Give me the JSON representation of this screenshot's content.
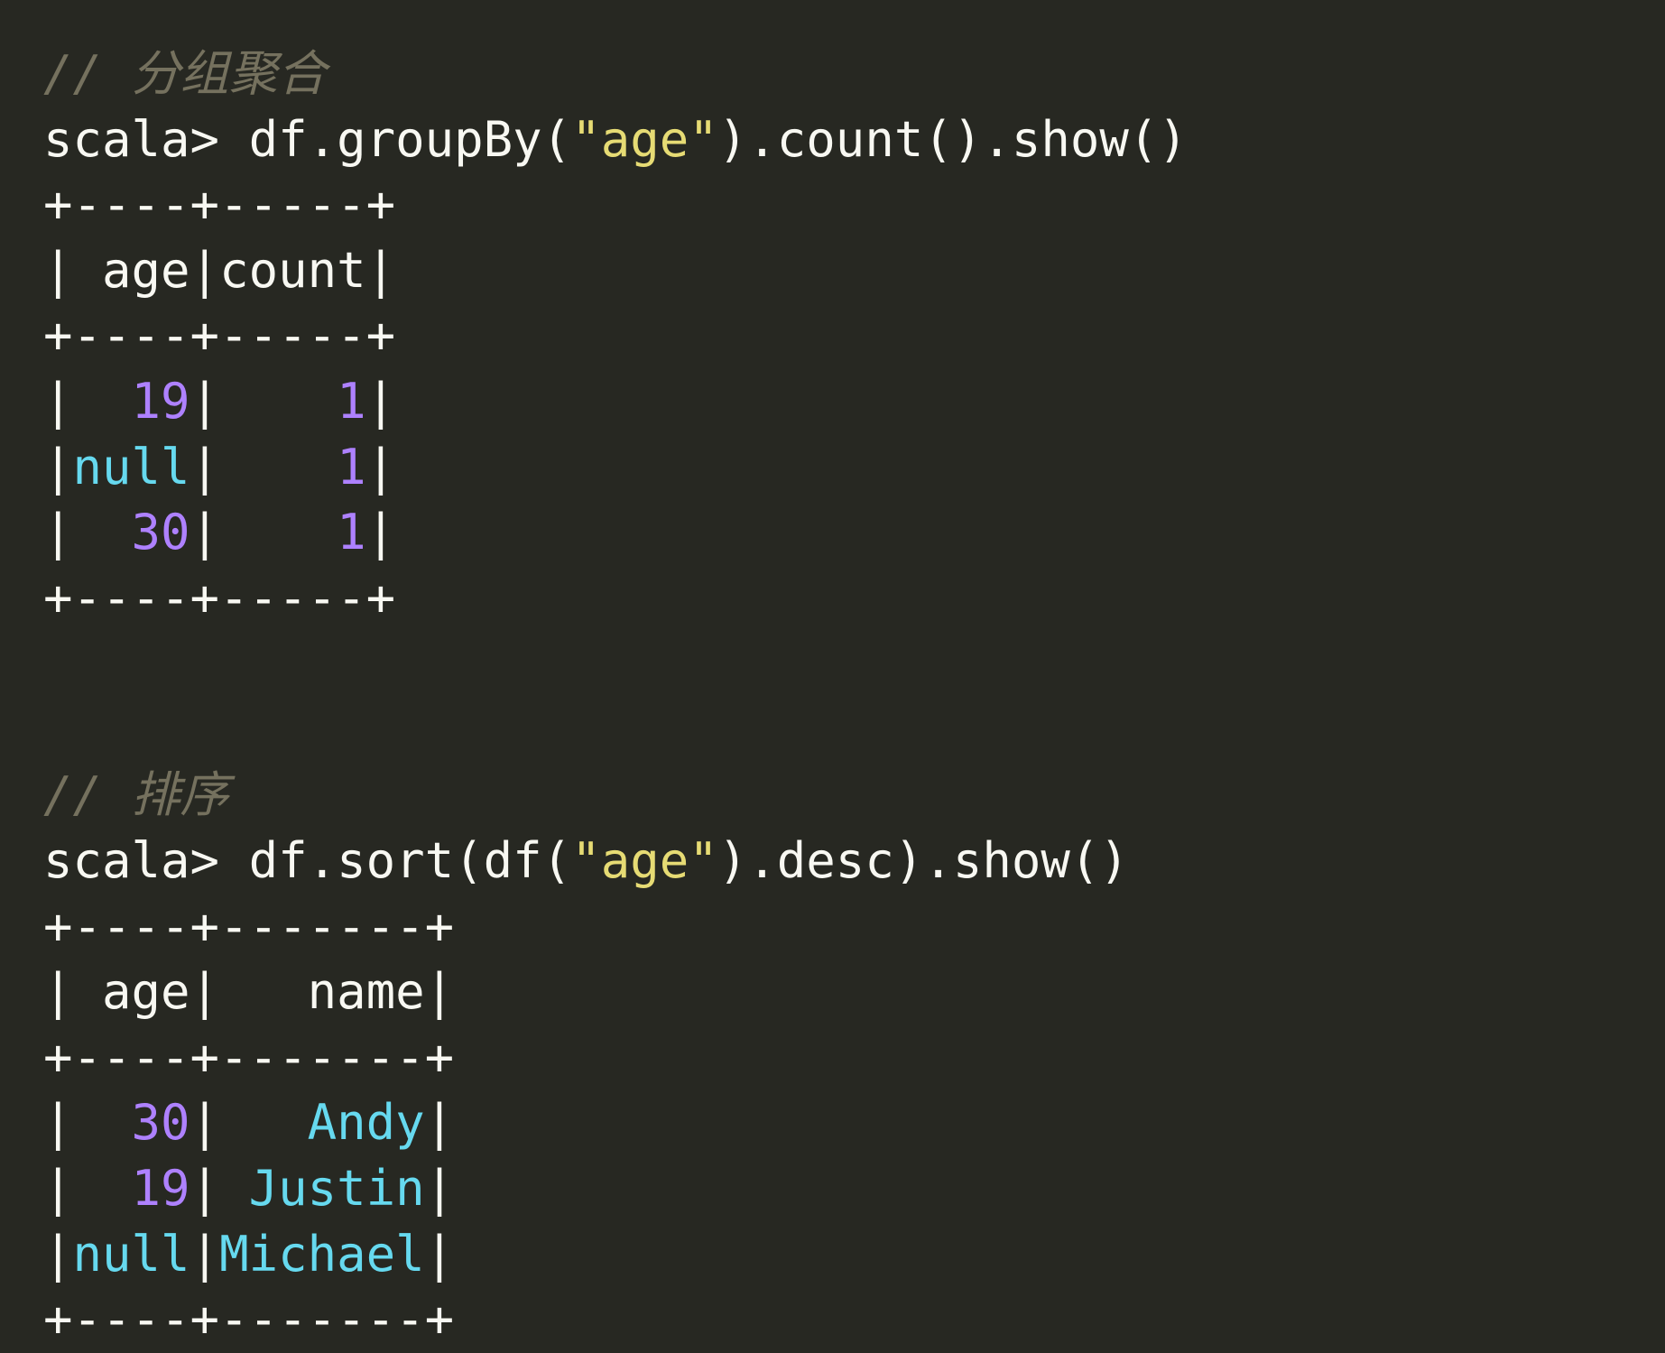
{
  "colors": {
    "background": "#272822",
    "text": "#f8f8f2",
    "comment": "#75715e",
    "string": "#e6db74",
    "number": "#ae81ff",
    "identifier": "#66d9ef"
  },
  "block1": {
    "comment": "// 分组聚合",
    "prompt": "scala> ",
    "cmd_pre": "df.groupBy(",
    "cmd_str": "\"age\"",
    "cmd_post": ").count().show()",
    "border": "+----+-----+",
    "header": "| age|count|",
    "rows": [
      {
        "lead": "|  ",
        "age": "19",
        "mid": "|    ",
        "count": "1",
        "end": "|"
      },
      {
        "lead": "|",
        "age": "null",
        "mid": "|    ",
        "count": "1",
        "end": "|"
      },
      {
        "lead": "|  ",
        "age": "30",
        "mid": "|    ",
        "count": "1",
        "end": "|"
      }
    ]
  },
  "block2": {
    "comment": "// 排序",
    "prompt": "scala> ",
    "cmd_pre": "df.sort(df(",
    "cmd_str": "\"age\"",
    "cmd_post": ").desc).show()",
    "border": "+----+-------+",
    "header": "| age|   name|",
    "rows": [
      {
        "lead": "|  ",
        "age": "30",
        "mid": "|   ",
        "name": "Andy",
        "end": "|"
      },
      {
        "lead": "|  ",
        "age": "19",
        "mid": "| ",
        "name": "Justin",
        "end": "|"
      },
      {
        "lead": "|",
        "age": "null",
        "mid": "|",
        "name": "Michael",
        "end": "|"
      }
    ]
  }
}
